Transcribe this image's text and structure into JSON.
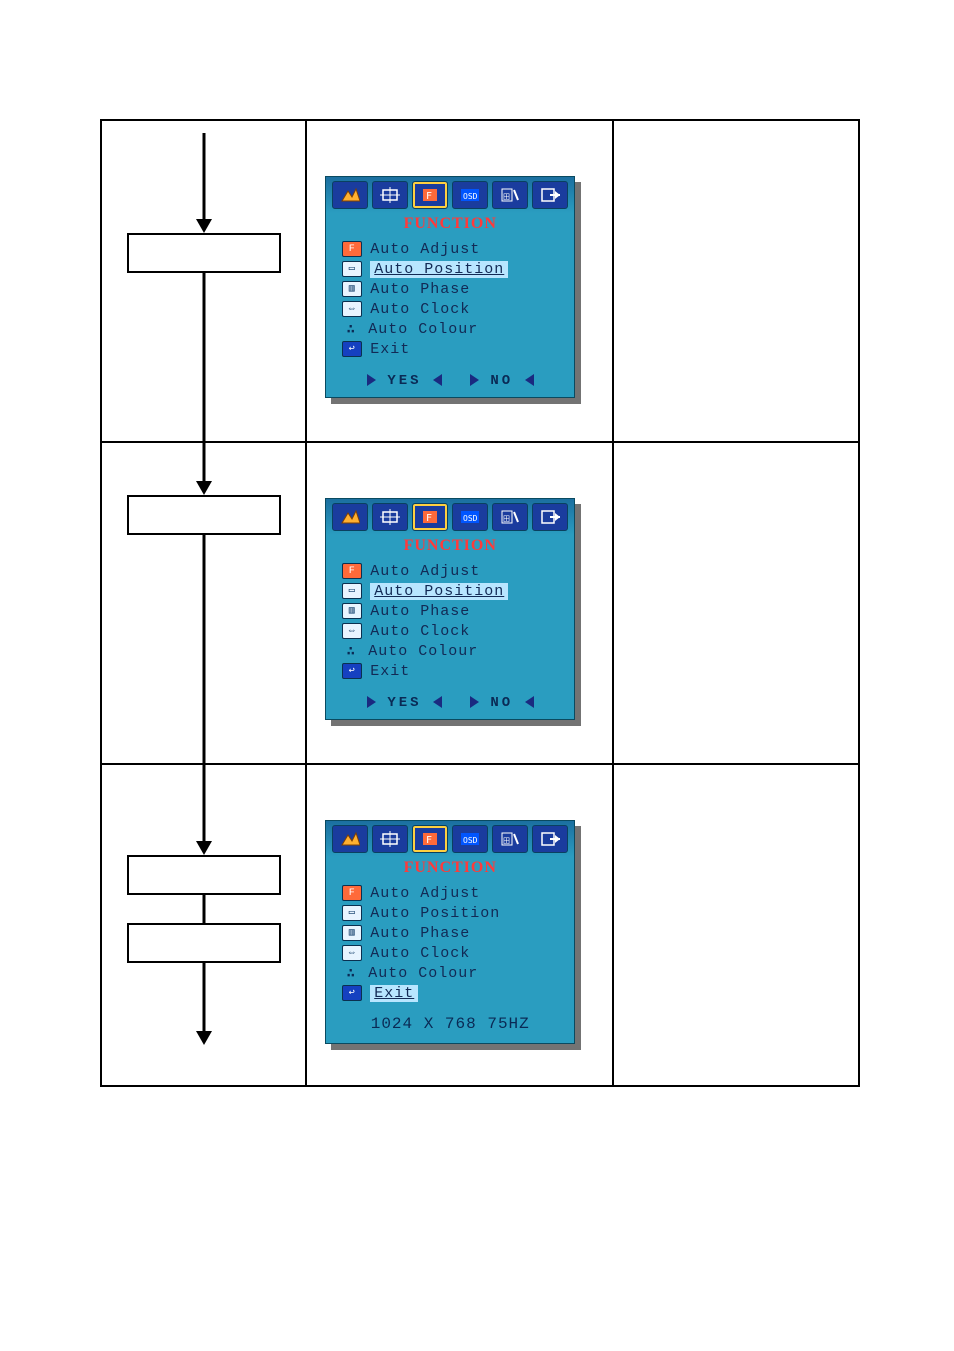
{
  "osd": {
    "title": "FUNCTION",
    "items": [
      {
        "id": "auto-adjust",
        "label": "Auto Adjust"
      },
      {
        "id": "auto-position",
        "label": "Auto Position"
      },
      {
        "id": "auto-phase",
        "label": "Auto Phase"
      },
      {
        "id": "auto-clock",
        "label": "Auto Clock"
      },
      {
        "id": "auto-colour",
        "label": "Auto Colour"
      },
      {
        "id": "exit",
        "label": "Exit"
      }
    ],
    "yes": "YES",
    "no": "NO",
    "resolution_line": "1024 X 768 75HZ"
  },
  "panels": [
    {
      "highlight_index": 1,
      "footer": "yesno"
    },
    {
      "highlight_index": 1,
      "footer": "yesno"
    },
    {
      "highlight_index": 5,
      "footer": "resolution"
    }
  ]
}
